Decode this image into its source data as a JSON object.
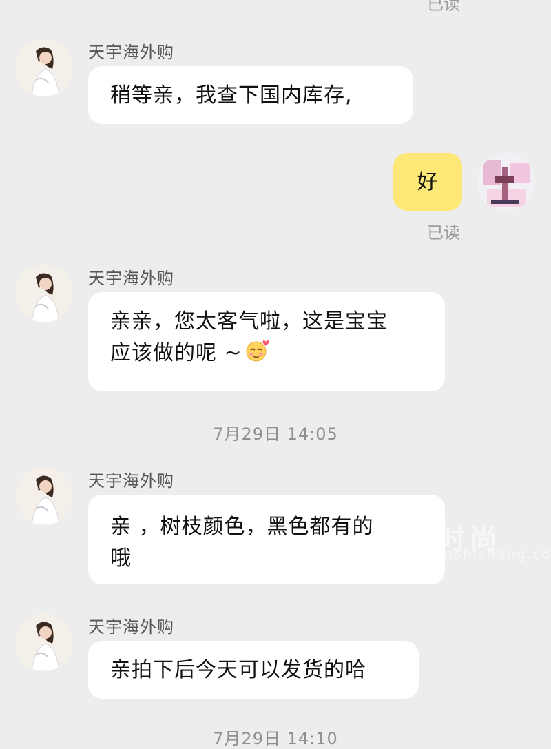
{
  "top_read": "已读",
  "messages": [
    {
      "sender": "天宇海外购",
      "text": "稍等亲，我查下国内库存,"
    },
    {
      "text": "好",
      "status": "已读"
    },
    {
      "sender": "天宇海外购",
      "line1": "亲亲，您太客气啦，这是宝宝",
      "line2": "应该做的呢 ~"
    },
    {
      "sender": "天宇海外购",
      "line1": "亲 ，树枝颜色，黑色都有的",
      "line2": "哦"
    },
    {
      "sender": "天宇海外购",
      "text": "亲拍下后今天可以发货的哈"
    }
  ],
  "timestamps": [
    "7月29日 14:05",
    "7月29日 14:10"
  ],
  "watermark": {
    "main": "依兰时尚",
    "sub": "www.yilanshishang.com"
  },
  "icons": {
    "emoji": "blushing-face-heart-icon"
  },
  "colors": {
    "background": "#ededed",
    "my_bubble": "#fde777",
    "other_bubble": "#ffffff"
  }
}
